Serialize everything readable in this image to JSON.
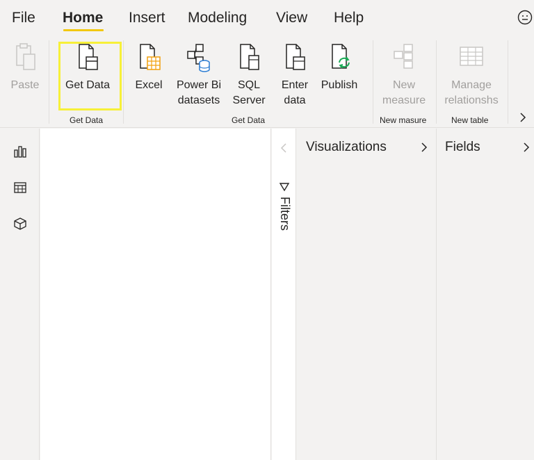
{
  "menu": {
    "items": [
      {
        "label": "File"
      },
      {
        "label": "Home"
      },
      {
        "label": "Insert"
      },
      {
        "label": "Modeling"
      },
      {
        "label": "View"
      },
      {
        "label": "Help"
      }
    ],
    "active": "Home",
    "accent_color": "#f2c811"
  },
  "ribbon": {
    "paste": {
      "label": "Paste",
      "icon": "clipboard-icon"
    },
    "get_data": {
      "label": "Get Data",
      "icon": "database-file-icon"
    },
    "excel": {
      "label": "Excel",
      "icon": "excel-icon"
    },
    "powerbi": {
      "label_line1": "Power Bi",
      "label_line2": "datasets",
      "icon": "dataset-icon"
    },
    "sql": {
      "label_line1": "SQL",
      "label_line2": "Server",
      "icon": "sql-server-icon"
    },
    "enter": {
      "label_line1": "Enter",
      "label_line2": "data",
      "icon": "table-file-icon"
    },
    "publish": {
      "label": "Publish",
      "icon": "publish-icon"
    },
    "new_measure": {
      "label_line1": "New",
      "label_line2": "measure",
      "icon": "measure-icon"
    },
    "manage_rel": {
      "label_line1": "Manage",
      "label_line2": "relationshs",
      "icon": "relationships-icon"
    },
    "groups": {
      "get_data_small": "Get Data",
      "get_data": "Get Data",
      "new_measure": "New masure",
      "new_table": "New table"
    },
    "highlight_color": "#f7f038"
  },
  "left_rail": {
    "items": [
      {
        "icon": "report-view-icon"
      },
      {
        "icon": "data-view-icon"
      },
      {
        "icon": "model-view-icon"
      }
    ]
  },
  "filters": {
    "label": "Filters"
  },
  "panes": {
    "visualizations": {
      "title": "Visualizations"
    },
    "fields": {
      "title": "Fields"
    }
  }
}
